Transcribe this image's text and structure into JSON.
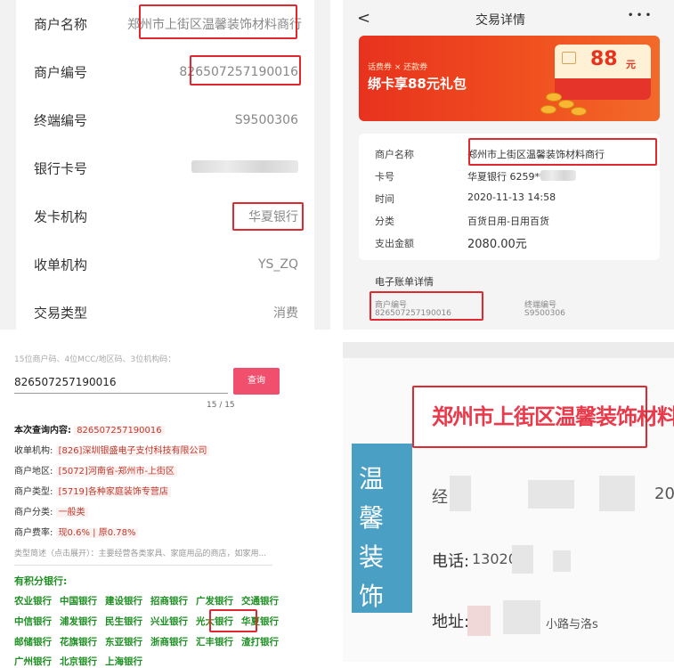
{
  "merchant_panel": {
    "rows": [
      {
        "label": "商户名称",
        "value": "郑州市上街区温馨装饰材料商行"
      },
      {
        "label": "商户编号",
        "value": "826507257190016"
      },
      {
        "label": "终端编号",
        "value": "S9500306"
      },
      {
        "label": "银行卡号",
        "value": ""
      },
      {
        "label": "发卡机构",
        "value": "华夏银行"
      },
      {
        "label": "收单机构",
        "value": "YS_ZQ"
      },
      {
        "label": "交易类型",
        "value": "消费"
      }
    ]
  },
  "transaction_panel": {
    "back": "<",
    "title": "交易详情",
    "more": "• • •",
    "banner": {
      "small": "话费券 × 还款券",
      "main": "绑卡享88元礼包",
      "amount": "88",
      "unit": "元"
    },
    "rows": [
      {
        "label": "商户名称",
        "value": "郑州市上街区温馨装饰材料商行"
      },
      {
        "label": "卡号",
        "value": "华夏银行  6259***"
      },
      {
        "label": "时间",
        "value": "2020-11-13  14:58"
      },
      {
        "label": "分类",
        "value": "百货日用-日用百货"
      },
      {
        "label": "支出金额",
        "value": "2080.00元"
      }
    ],
    "ebill_title": "电子账单详情",
    "merchant_no_label": "商户编号",
    "merchant_no": "826507257190016",
    "terminal_label": "终端编号",
    "terminal_no": "S9500306"
  },
  "query_panel": {
    "hint": "15位商户码、4位MCC/地区码、3位机构码：",
    "input_value": "826507257190016",
    "button": "查询",
    "counter": "15 / 15",
    "results": [
      {
        "label": "本次查询内容:",
        "value": "826507257190016"
      },
      {
        "label": "收单机构:",
        "value": "[826]深圳银盛电子支付科技有限公司"
      },
      {
        "label": "商户地区:",
        "value": "[5072]河南省-郑州市-上街区"
      },
      {
        "label": "商户类型:",
        "value": "[5719]各种家庭装饰专营店"
      },
      {
        "label": "商户分类:",
        "value": "一般类"
      },
      {
        "label": "商户费率:",
        "value": "现0.6% | 原0.78%"
      }
    ],
    "desc": "类型简述（点击展开）：主要经营各类家具、家庭用品的商店，如家用...",
    "points_title": "有积分银行:",
    "banks": [
      [
        "农业银行",
        "中国银行",
        "建设银行",
        "招商银行",
        "广发银行",
        "交通银行"
      ],
      [
        "中信银行",
        "浦发银行",
        "民生银行",
        "兴业银行",
        "光大银行",
        "华夏银行"
      ],
      [
        "邮储银行",
        "花旗银行",
        "东亚银行",
        "浙商银行",
        "汇丰银行",
        "渣打银行"
      ],
      [
        "广州银行",
        "北京银行",
        "上海银行"
      ]
    ]
  },
  "storefront_panel": {
    "sign": "郑州市上街区温馨装饰材料商行",
    "side_sign": "温馨装饰",
    "line1_prefix": "经",
    "line1_suffix": "20",
    "phone_label": "电话:",
    "phone_value": "13020",
    "address_label": "地址:",
    "address_tail": "小路与洛s"
  }
}
